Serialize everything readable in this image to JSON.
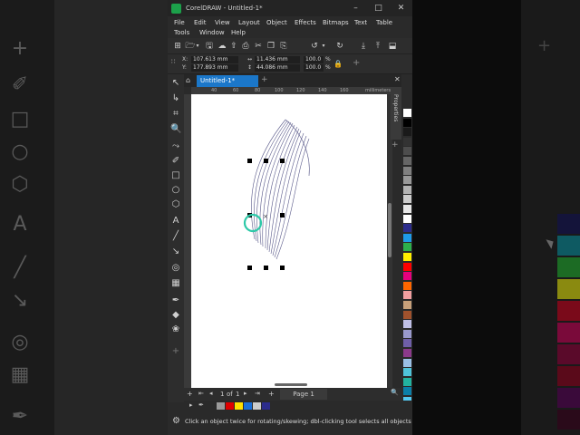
{
  "window": {
    "title": "CorelDRAW - Untitled-1*",
    "minimize_glyph": "–",
    "maximize_glyph": "□",
    "close_glyph": "✕"
  },
  "menu": {
    "row1": [
      "File",
      "Edit",
      "View",
      "Layout",
      "Object",
      "Effects",
      "Bitmaps",
      "Text",
      "Table"
    ],
    "row2": [
      "Tools",
      "Window",
      "Help"
    ]
  },
  "property_bar": {
    "x_label": "X:",
    "x_value": "107.613 mm",
    "y_label": "Y:",
    "y_value": "177.893 mm",
    "width_value": "11.436 mm",
    "height_value": "44.086 mm",
    "scale_x": "100.0",
    "scale_y": "100.0",
    "percent": "%"
  },
  "tabs": {
    "document_label": "Untitled-1*",
    "add_glyph": "+"
  },
  "docker": {
    "properties_label": "Properties"
  },
  "ruler": {
    "top_ticks": [
      "40",
      "60",
      "80",
      "100",
      "120",
      "140",
      "160"
    ],
    "units": "millimeters"
  },
  "page_nav": {
    "current": "1",
    "of_label": "of",
    "total": "1",
    "page_label": "Page 1"
  },
  "status": {
    "message": "Click an object twice for rotating/skewing; dbl-clicking tool selects all objects; Shift+click mu"
  },
  "palette_colors": [
    "#ffffff",
    "#000000",
    "#1a1a1a",
    "#333333",
    "#4d4d4d",
    "#666666",
    "#808080",
    "#999999",
    "#b3b3b3",
    "#cccccc",
    "#e6e6e6",
    "#ffffff",
    "#2c2c8c",
    "#1e9be8",
    "#2db04b",
    "#ffee00",
    "#ff0000",
    "#e6007e",
    "#ff6600",
    "#f29fa0",
    "#c7a07a",
    "#a0522d",
    "#bfbfe6",
    "#9999cc",
    "#6f5fa8",
    "#8b3a8b",
    "#9bc0e6",
    "#4fc3d9",
    "#22b3a0",
    "#0b7fa8",
    "#55c9f0"
  ],
  "document_colors": [
    "#9a9a9a",
    "#e00000",
    "#ffe000",
    "#1b6fd8",
    "#cccccc",
    "#2c2c8c"
  ],
  "highlight_color": "#2dc9a8",
  "bg_right_swatches": [
    "#14143a",
    "#0e5a62",
    "#1c6b24",
    "#8a8a10",
    "#7a0a1a",
    "#7a0a3a",
    "#5a0a2a",
    "#5a0a1a",
    "#3a0a3a",
    "#2a0a1a",
    "#1a1a2a",
    "#111111"
  ]
}
